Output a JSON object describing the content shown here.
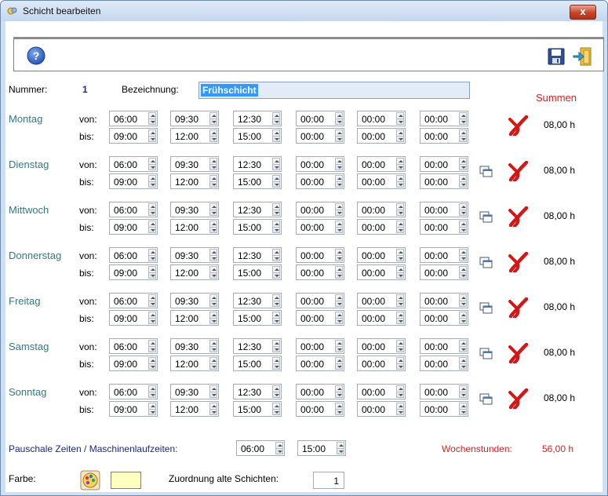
{
  "window": {
    "title": "Schicht bearbeiten",
    "close": "x"
  },
  "toolbar": {
    "help_icon": "help-icon",
    "save_icon": "save-icon",
    "exit_icon": "exit-icon"
  },
  "header": {
    "nummer_label": "Nummer:",
    "nummer_value": "1",
    "bezeichnung_label": "Bezeichnung:",
    "bezeichnung_value": "Frühschicht",
    "summen_label": "Summen"
  },
  "labels": {
    "von": "von:",
    "bis": "bis:"
  },
  "days": [
    {
      "name": "Montag",
      "von": [
        "06:00",
        "09:30",
        "12:30",
        "00:00",
        "00:00",
        "00:00"
      ],
      "bis": [
        "09:00",
        "12:00",
        "15:00",
        "00:00",
        "00:00",
        "00:00"
      ],
      "sum": "08,00 h",
      "copy": false
    },
    {
      "name": "Dienstag",
      "von": [
        "06:00",
        "09:30",
        "12:30",
        "00:00",
        "00:00",
        "00:00"
      ],
      "bis": [
        "09:00",
        "12:00",
        "15:00",
        "00:00",
        "00:00",
        "00:00"
      ],
      "sum": "08,00 h",
      "copy": true
    },
    {
      "name": "Mittwoch",
      "von": [
        "06:00",
        "09:30",
        "12:30",
        "00:00",
        "00:00",
        "00:00"
      ],
      "bis": [
        "09:00",
        "12:00",
        "15:00",
        "00:00",
        "00:00",
        "00:00"
      ],
      "sum": "08,00 h",
      "copy": true
    },
    {
      "name": "Donnerstag",
      "von": [
        "06:00",
        "09:30",
        "12:30",
        "00:00",
        "00:00",
        "00:00"
      ],
      "bis": [
        "09:00",
        "12:00",
        "15:00",
        "00:00",
        "00:00",
        "00:00"
      ],
      "sum": "08,00 h",
      "copy": true
    },
    {
      "name": "Freitag",
      "von": [
        "06:00",
        "09:30",
        "12:30",
        "00:00",
        "00:00",
        "00:00"
      ],
      "bis": [
        "09:00",
        "12:00",
        "15:00",
        "00:00",
        "00:00",
        "00:00"
      ],
      "sum": "08,00 h",
      "copy": true
    },
    {
      "name": "Samstag",
      "von": [
        "06:00",
        "09:30",
        "12:30",
        "00:00",
        "00:00",
        "00:00"
      ],
      "bis": [
        "09:00",
        "12:00",
        "15:00",
        "00:00",
        "00:00",
        "00:00"
      ],
      "sum": "08,00 h",
      "copy": true
    },
    {
      "name": "Sonntag",
      "von": [
        "06:00",
        "09:30",
        "12:30",
        "00:00",
        "00:00",
        "00:00"
      ],
      "bis": [
        "09:00",
        "12:00",
        "15:00",
        "00:00",
        "00:00",
        "00:00"
      ],
      "sum": "08,00 h",
      "copy": true
    }
  ],
  "footer": {
    "pauschale_label": "Pauschale Zeiten / Maschinenlaufzeiten:",
    "pauschale_von": "06:00",
    "pauschale_bis": "15:00",
    "wochenstunden_label": "Wochenstunden:",
    "wochenstunden_value": "56,00 h",
    "farbe_label": "Farbe:",
    "farbe_value": "#ffffc0",
    "zuordnung_label": "Zuordnung alte Schichten:",
    "zuordnung_value": "1"
  },
  "colors": {
    "day_label": "#2f7c86",
    "summen": "#e02020",
    "footer_label": "#1a2a8a",
    "delete_x": "#d01818"
  }
}
